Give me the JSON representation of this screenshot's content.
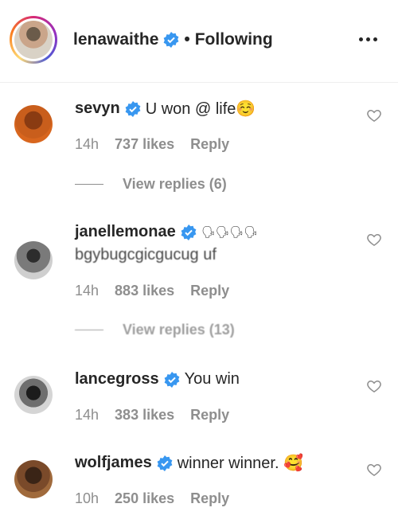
{
  "header": {
    "username": "lenawaithe",
    "separator": "•",
    "follow_status": "Following"
  },
  "comments": [
    {
      "username": "sevyn",
      "text": "U won @ life☺️",
      "time": "14h",
      "likes": "737 likes",
      "reply": "Reply",
      "view_replies": "View replies (6)"
    },
    {
      "username": "janellemonae",
      "emoji": "🗣🗣🗣🗣",
      "text": "bgybugcgicgucug uf",
      "time": "14h",
      "likes": "883 likes",
      "reply": "Reply",
      "view_replies": "View replies (13)"
    },
    {
      "username": "lancegross",
      "text": "You win",
      "time": "14h",
      "likes": "383 likes",
      "reply": "Reply"
    },
    {
      "username": "wolfjames",
      "text": "winner winner. 🥰",
      "time": "10h",
      "likes": "250 likes",
      "reply": "Reply"
    }
  ],
  "colors": {
    "verified": "#3897f0",
    "muted": "#8e8e8e",
    "text": "#262626"
  }
}
